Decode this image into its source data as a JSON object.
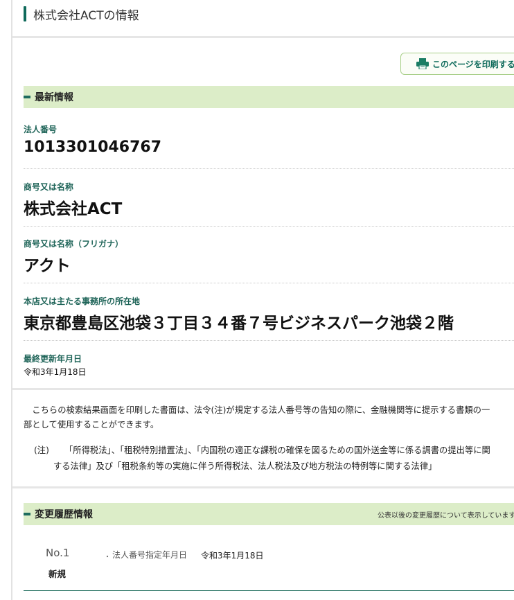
{
  "page_title": "株式会社ACTの情報",
  "print_button": "このページを印刷する",
  "latest": {
    "section_title": "最新情報",
    "fields": [
      {
        "label": "法人番号",
        "value": "1013301046767"
      },
      {
        "label": "商号又は名称",
        "value": "株式会社ACT"
      },
      {
        "label": "商号又は名称（フリガナ）",
        "value": "アクト"
      },
      {
        "label": "本店又は主たる事務所の所在地",
        "value": "東京都豊島区池袋３丁目３４番７号ビジネスパーク池袋２階"
      },
      {
        "label": "最終更新年月日",
        "value": "令和3年1月18日"
      }
    ]
  },
  "notice": {
    "line1": "　こちらの検索結果画面を印刷した書面は、法令(注)が規定する法人番号等の告知の際に、金融機関等に提示する書類の一",
    "line2": "部として使用することができます。",
    "note_mark": "(注)",
    "note_line1": "「所得税法」、「租税特別措置法」、「内国税の適正な課税の確保を図るための国外送金等に係る調書の提出等に関",
    "note_line2": "する法律」及び「租税条約等の実施に伴う所得税法、法人税法及び地方税法の特例等に関する法律」"
  },
  "history": {
    "section_title": "変更履歴情報",
    "note": "公表以後の変更履歴について表示しています",
    "entries": [
      {
        "no": "No.1",
        "kind": "新規",
        "item": "法人番号指定年月日",
        "date": "令和3年1月18日"
      }
    ]
  }
}
